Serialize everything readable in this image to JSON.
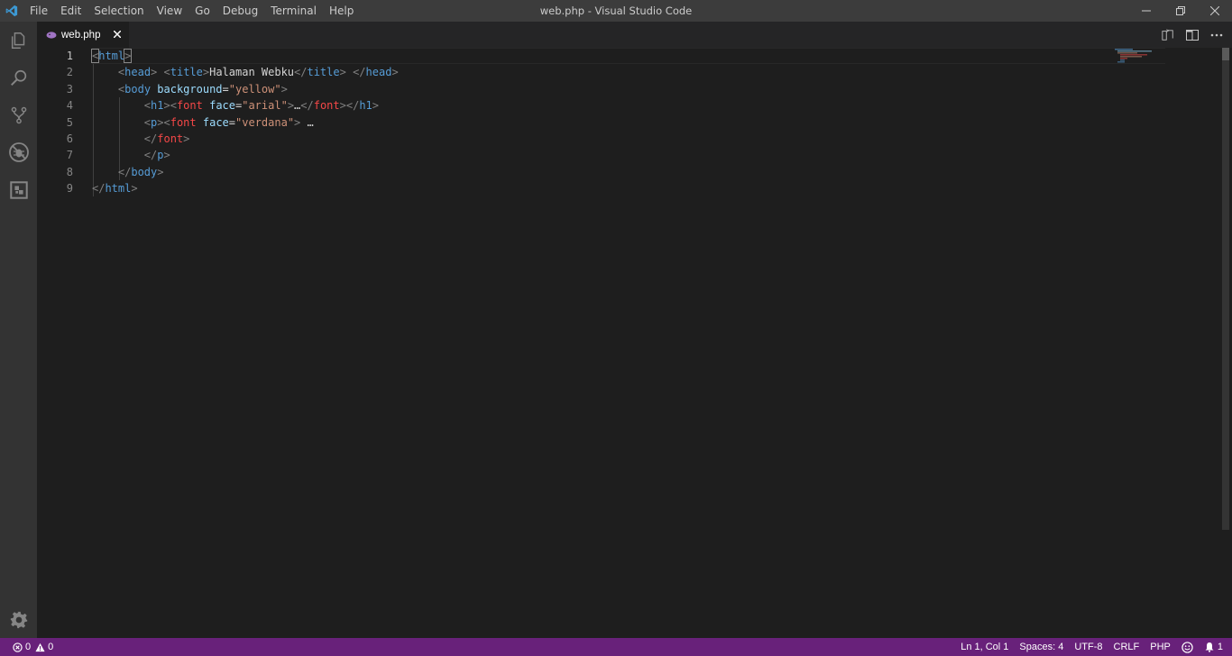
{
  "window": {
    "title": "web.php - Visual Studio Code"
  },
  "menu": [
    "File",
    "Edit",
    "Selection",
    "View",
    "Go",
    "Debug",
    "Terminal",
    "Help"
  ],
  "activity_bar": {
    "items": [
      {
        "icon": "explorer-icon"
      },
      {
        "icon": "search-icon"
      },
      {
        "icon": "source-control-icon"
      },
      {
        "icon": "debug-icon"
      },
      {
        "icon": "extensions-icon"
      }
    ],
    "bottom": {
      "icon": "gear-icon"
    }
  },
  "tab": {
    "label": "web.php",
    "icon": "php-file-icon",
    "icon_color": "#a074c4"
  },
  "editor": {
    "line_numbers": [
      "1",
      "2",
      "3",
      "4",
      "5",
      "6",
      "7",
      "8",
      "9"
    ],
    "active_line": 1
  },
  "status": {
    "errors": "0",
    "warnings": "0",
    "position": "Ln 1, Col 1",
    "spaces": "Spaces: 4",
    "encoding": "UTF-8",
    "eol": "CRLF",
    "language": "PHP",
    "notifications": "1",
    "background_color": "#68217a"
  },
  "colors": {
    "tag": "#569cd6",
    "attr": "#9cdcfe",
    "string": "#ce9178",
    "font_tag": "#f44747",
    "bracket": "#808080"
  }
}
